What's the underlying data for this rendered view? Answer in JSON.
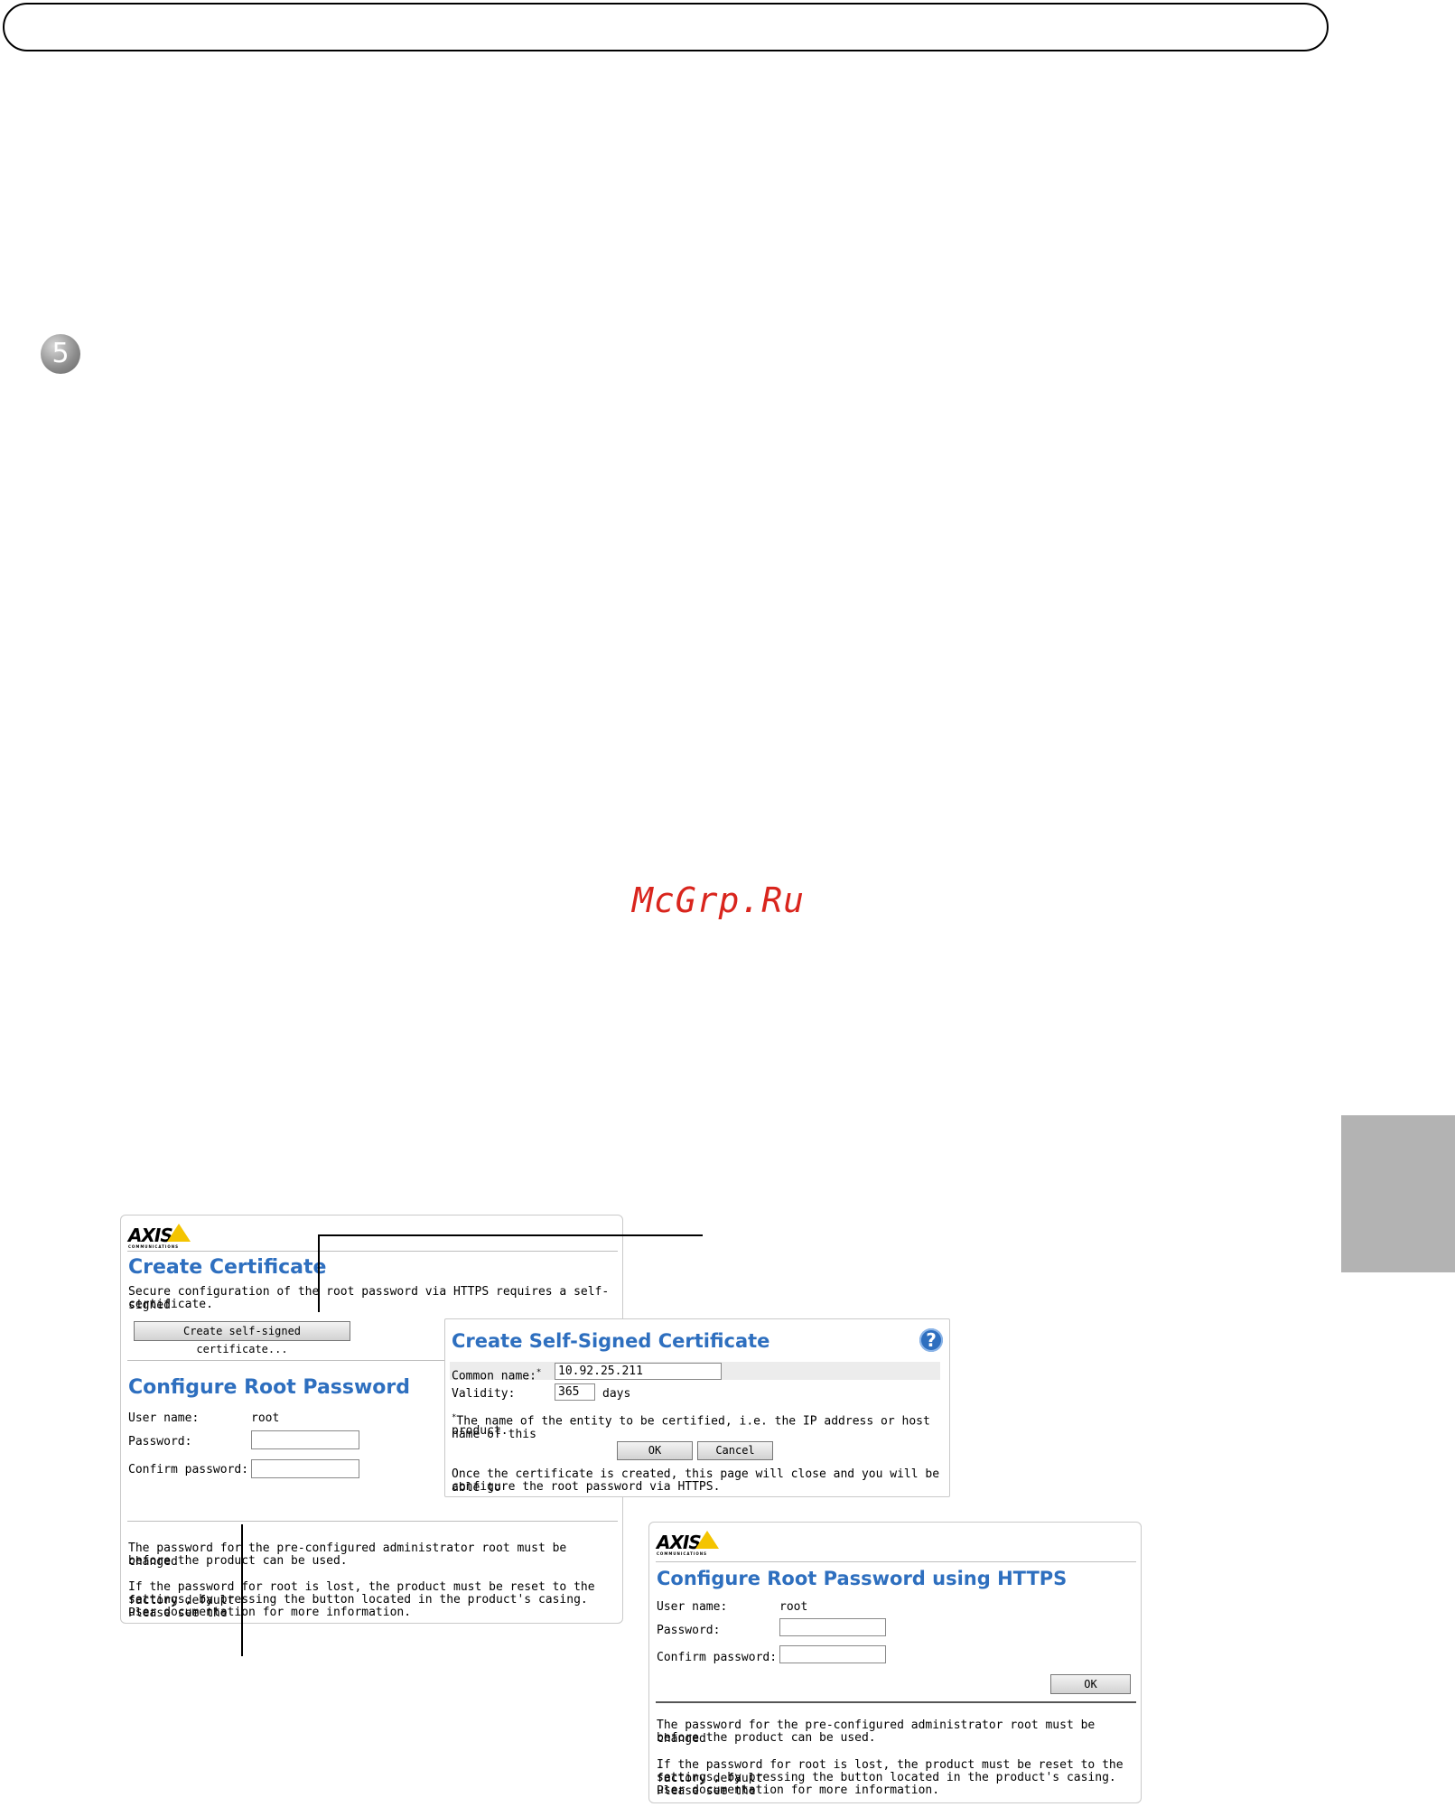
{
  "header": {
    "step_number": "5"
  },
  "watermark": "McGrp.Ru",
  "panel_create_cert": {
    "logo_text": "AXIS",
    "logo_subtext": "COMMUNICATIONS",
    "title": "Create Certificate",
    "description_line1": "Secure configuration of the root password via HTTPS requires a self-signed",
    "description_line2": "certificate.",
    "create_button": "Create self-signed certificate...",
    "root_title": "Configure Root Password",
    "username_label": "User name:",
    "username_value": "root",
    "password_label": "Password:",
    "confirm_label": "Confirm password:",
    "note1_line1": "The password for the pre-configured administrator root must be changed",
    "note1_line2": "before the product can be used.",
    "note2_line1": "If the password for root is lost, the product must be reset to the factory default",
    "note2_line2": "settings, by pressing the button located in the product's casing. Please see the",
    "note2_line3": "user documentation for more information."
  },
  "panel_self_signed": {
    "title": "Create Self-Signed Certificate",
    "help_icon": "?",
    "common_name_label": "Common name:",
    "common_name_marker": "*",
    "common_name_value": "10.92.25.211",
    "validity_label": "Validity:",
    "validity_value": "365",
    "validity_unit": "days",
    "footnote_marker": "*",
    "footnote_line1": "The name of the entity to be certified, i.e. the IP address or host name of this",
    "footnote_line2": "product.",
    "ok_button": "OK",
    "cancel_button": "Cancel",
    "info_line1": "Once the certificate is created, this page will close and you will be able to",
    "info_line2": "configure the root password via HTTPS."
  },
  "panel_https": {
    "logo_text": "AXIS",
    "logo_subtext": "COMMUNICATIONS",
    "title": "Configure Root Password using HTTPS",
    "username_label": "User name:",
    "username_value": "root",
    "password_label": "Password:",
    "confirm_label": "Confirm password:",
    "ok_button": "OK",
    "note1_line1": "The password for the pre-configured administrator root must be changed",
    "note1_line2": "before the product can be used.",
    "note2_line1": "If the password for root is lost, the product must be reset to the factory default",
    "note2_line2": "settings, by pressing the button located in the product's casing. Please see the",
    "note2_line3": "user documentation for more information."
  }
}
